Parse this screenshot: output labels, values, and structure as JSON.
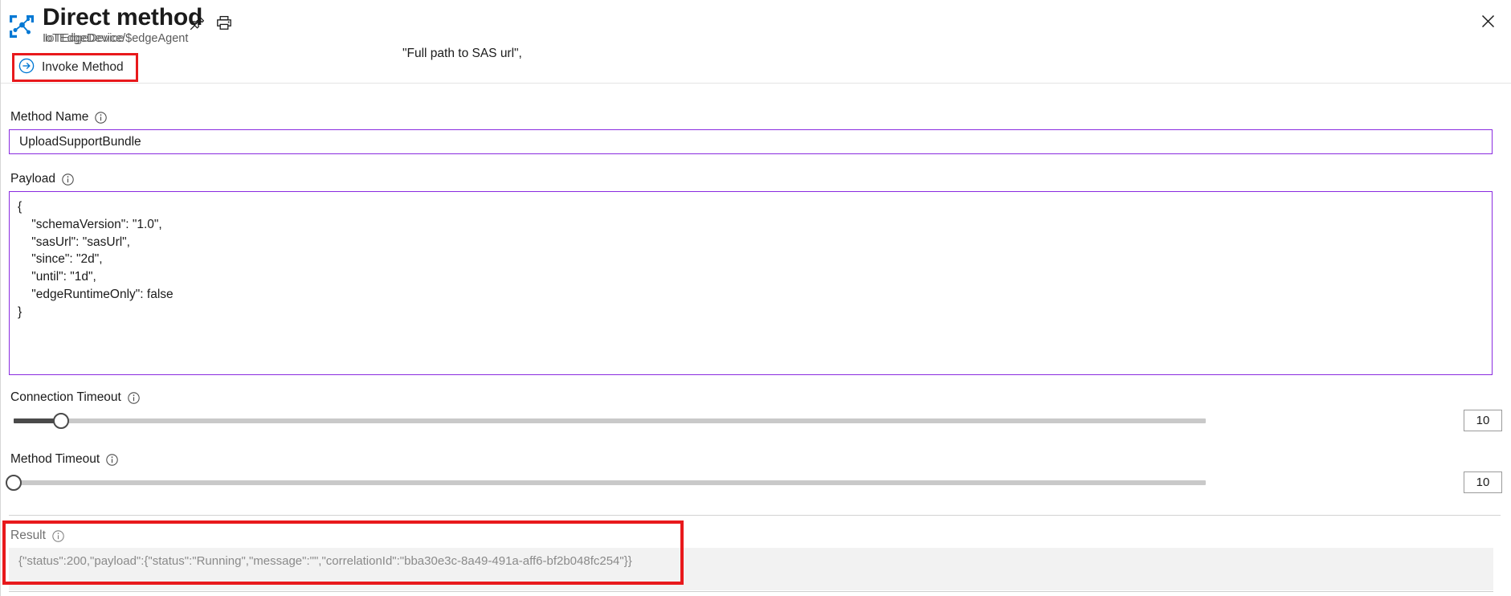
{
  "header": {
    "icon_name": "iot-hub-icon",
    "title": "Direct method",
    "subtitle": "IoTEdgeDevice/$edgeAgent",
    "subtitle_smudged_part": "IoTEdgeDevice",
    "subtitle_tail": "/$edgeAgent",
    "pin_label": "Pin blade",
    "print_label": "Print",
    "close_label": "Close"
  },
  "command_bar": {
    "invoke_label": "Invoke Method",
    "invoke_icon": "arrow-right-circle-icon",
    "highlight_color": "#e8191c"
  },
  "annotation": {
    "text": "\"Full path to SAS url\","
  },
  "form": {
    "method_name": {
      "label": "Method Name",
      "value": "UploadSupportBundle",
      "placeholder": "",
      "border_color": "#8a2be0"
    },
    "payload": {
      "label": "Payload",
      "border_color": "#8a2be0",
      "lines": [
        "{",
        "    \"schemaVersion\": \"1.0\",",
        "    \"sasUrl\": \"sasUrl\",",
        "    \"since\": \"2d\",",
        "    \"until\": \"1d\",",
        "    \"edgeRuntimeOnly\": false",
        "}"
      ]
    },
    "connection_timeout": {
      "label": "Connection Timeout",
      "value": "10",
      "thumb_percent": 4,
      "fill_percent": 4
    },
    "method_timeout": {
      "label": "Method Timeout",
      "value": "10",
      "thumb_percent": 0,
      "fill_percent": 0
    }
  },
  "result": {
    "label": "Result",
    "value": "{\"status\":200,\"payload\":{\"status\":\"Running\",\"message\":\"\",\"correlationId\":\"bba30e3c-8a49-491a-aff6-bf2b048fc254\"}}",
    "background": "#f2f2f2",
    "text_color": "#8a8a8a",
    "highlight_color": "#e8191c"
  },
  "icons": {
    "info": "info-circle-icon"
  }
}
